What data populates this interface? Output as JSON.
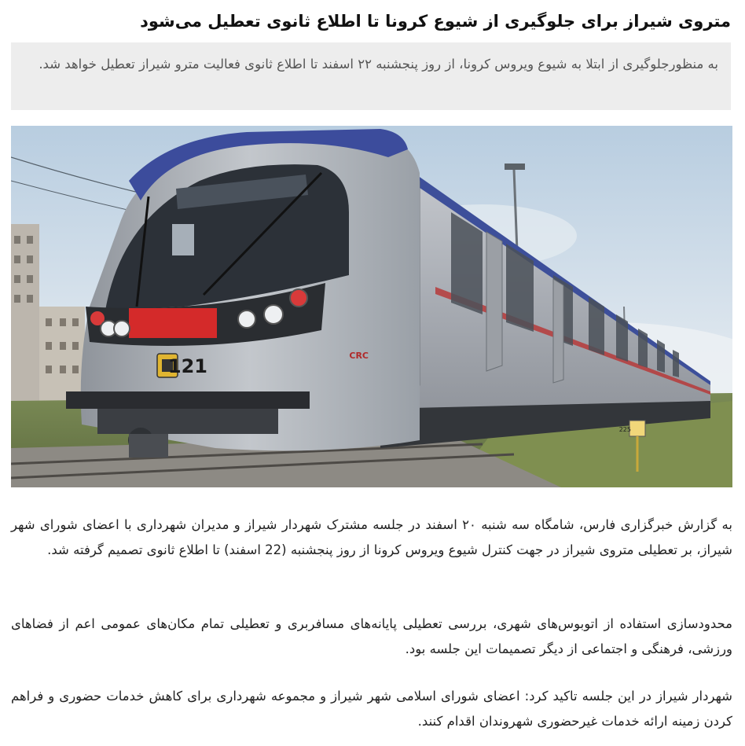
{
  "article": {
    "headline": "متروی شیراز برای جلوگیری از شیوع کرونا تا اطلاع ثانوی تعطیل می‌شود",
    "lead": "به منظورجلوگیری از ابتلا به شیوع ویروس کرونا، از روز پنجشنبه ۲۲ اسفند تا اطلاع ثانوی فعالیت مترو شیراز تعطیل خواهد شد.",
    "photo": {
      "train_number": "121",
      "maker_mark": "CRC",
      "post_number": "225"
    },
    "paragraphs": [
      "به گزارش خبرگزاری فارس، شامگاه سه شنبه ۲۰ اسفند در جلسه مشترک شهردار شیراز و مدیران شهرداری با اعضای شورای شهر شیراز،  بر تعطیلی متروی شیراز در جهت کنترل شیوع ویروس کرونا از روز پنجشنبه (22 اسفند) تا اطلاع ثانوی تصمیم گرفته شد.",
      "محدودسازی استفاده از اتوبوس‌های شهری، بررسی تعطیلی پایانه‌های مسافربری و تعطیلی تمام مکان‌های عمومی اعم از فضاهای ورزشی، فرهنگی و اجتماعی از دیگر تصمیمات این جلسه بود.",
      "شهردار شیراز در این جلسه تاکید کرد: اعضای شورای اسلامی شهر شیراز و مجموعه شهرداری برای کاهش خدمات حضوری و فراهم کردن زمینه ارائه خدمات غیرحضوری شهروندان اقدام کنند."
    ]
  }
}
